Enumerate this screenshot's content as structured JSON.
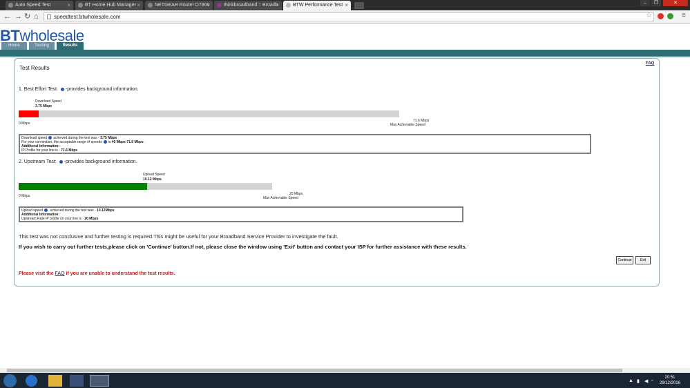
{
  "browser": {
    "tabs": [
      {
        "label": "Auto Speed Test"
      },
      {
        "label": "BT Home Hub Manager"
      },
      {
        "label": "NETGEAR Router D7800"
      },
      {
        "label": "thinkbroadband :: Broadb"
      },
      {
        "label": "BTW Performance Test"
      }
    ],
    "url": "speedtest.btwholesale.com"
  },
  "site": {
    "logo_bt": "BT",
    "logo_wholesale": "wholesale",
    "nav": [
      "Home",
      "Testing",
      "Results"
    ]
  },
  "results": {
    "faq": "FAQ",
    "title": "Test Results",
    "download": {
      "section_title_prefix": "1. Best Effort Test:",
      "section_title_suffix": "-provides background information.",
      "speed_label": "Download Speed",
      "speed_value": "3.75 Mbps",
      "zero_label": "0 Mbps",
      "max_value": "71.6 Mbps",
      "max_label": "Max Achievable Speed",
      "fraction": 0.0524,
      "bar_color": "#ff0000",
      "box_line1_a": "Download speed",
      "box_line1_b": "achieved during the test was - ",
      "box_line1_c": "3.75 Mbps",
      "box_line2_a": "For your connection, the acceptable range of speeds",
      "box_line2_b": "is ",
      "box_line2_c": "40 Mbps-71.6 Mbps",
      "box_line2_d": " .",
      "box_line3": "Additional Information:",
      "box_line4_a": "IP Profile for your line is - ",
      "box_line4_b": "71.6 Mbps"
    },
    "upload": {
      "section_title_prefix": "2. Upstream Test:",
      "section_title_suffix": "-provides background information.",
      "speed_label": "Upload Speed",
      "speed_value": "10.12 Mbps",
      "zero_label": "0 Mbps",
      "max_value": "20 Mbps",
      "max_label": "Max Achievable Speed",
      "fraction": 0.506,
      "bar_color": "#008000",
      "box_line1_a": "Upload speed",
      "box_line1_b": " achieved during the test was - ",
      "box_line1_c": "10.12Mbps",
      "box_line2": "Additional Information:",
      "box_line3_a": "Upstream Rate IP profile on your line is - ",
      "box_line3_b": "20 Mbps"
    },
    "message1": "This test was not conclusive and further testing is required.This might be useful for your Broadband Service Provider to investigate the fault.",
    "message2": "If you wish to carry out further tests,please click on 'Continue' button.If not, please close the window using 'Exit' button and contact your ISP for further assistance with these results.",
    "continue_label": "Continue",
    "exit_label": "Exit",
    "faq_msg_prefix": "Please visit the ",
    "faq_msg_link": "FAQ",
    "faq_msg_suffix": " if you are unable to understand the test results."
  },
  "taskbar": {
    "time": "20:51",
    "date": "29/12/2016"
  }
}
